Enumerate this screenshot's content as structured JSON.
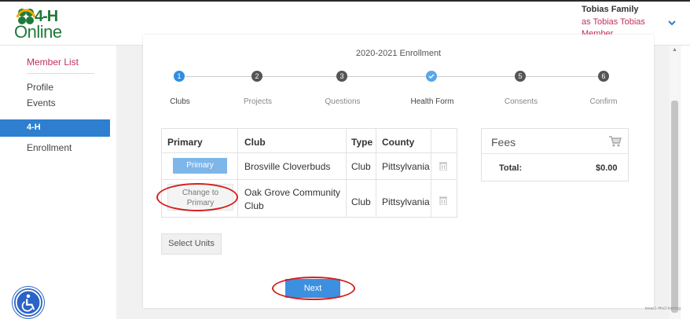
{
  "header": {
    "logo_text_top": "4-H",
    "logo_text_bottom": "Online",
    "user_name": "Tobias Family",
    "user_as": "as Tobias Tobias",
    "user_role": "Member"
  },
  "sidebar": {
    "member_list": "Member List",
    "profile": "Profile",
    "events": "Events",
    "active_section": "4-H",
    "enrollment": "Enrollment"
  },
  "page": {
    "title": "2020-2021 Enrollment"
  },
  "steps": [
    {
      "number": "1",
      "label": "Clubs",
      "state": "active"
    },
    {
      "number": "2",
      "label": "Projects",
      "state": "todo"
    },
    {
      "number": "3",
      "label": "Questions",
      "state": "todo"
    },
    {
      "number": "",
      "label": "Health Form",
      "state": "done"
    },
    {
      "number": "5",
      "label": "Consents",
      "state": "todo"
    },
    {
      "number": "6",
      "label": "Confirm",
      "state": "todo"
    }
  ],
  "table": {
    "headers": [
      "Primary",
      "Club",
      "Type",
      "County"
    ],
    "rows": [
      {
        "primary_button": "Primary",
        "club": "Brosville Cloverbuds",
        "type": "Club",
        "county": "Pittsylvania"
      },
      {
        "primary_button": "Change to Primary",
        "club": "Oak Grove Community Club",
        "type": "Club",
        "county": "Pittsylvania"
      }
    ]
  },
  "fees": {
    "title": "Fees",
    "total_label": "Total:",
    "total_value": "$0.00"
  },
  "actions": {
    "select_units": "Select Units",
    "next": "Next"
  },
  "footer": {
    "tag": "texas1-4hv2-training"
  },
  "colors": {
    "accent": "#2e7fd0",
    "brand_pink": "#c0325a",
    "brand_green": "#1f7a3a",
    "highlight": "#d42020"
  }
}
